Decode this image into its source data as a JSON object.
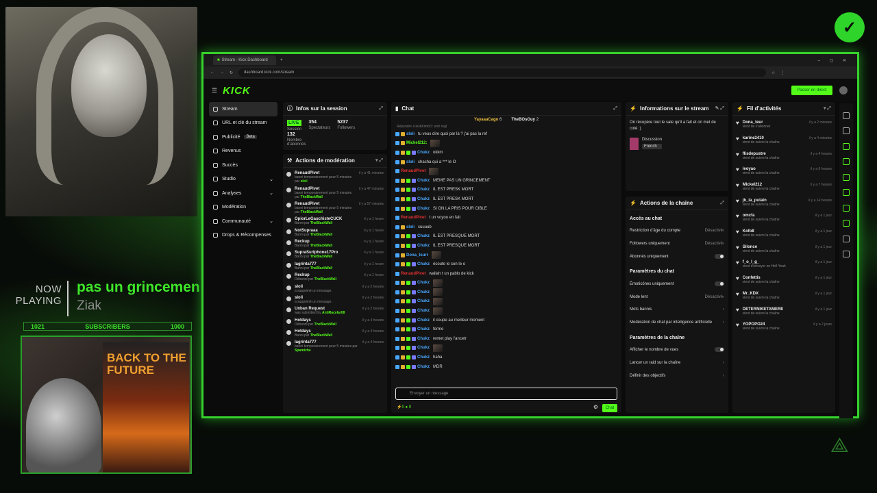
{
  "overlay": {
    "now_playing": "NOW PLAYING",
    "song": "pas un grincemen",
    "artist": "Ziak",
    "sub_left": "1021",
    "sub_label": "SUBSCRIBERS",
    "sub_right": "1000",
    "poster_text": "BACK TO THE FUTURE"
  },
  "browser": {
    "tab_title": "Stream - Kick Dashboard",
    "url": "dashboard.kick.com/stream"
  },
  "app": {
    "logo": "KICK",
    "go_live": "Passer en direct"
  },
  "sidebar": {
    "items": [
      {
        "label": "Stream"
      },
      {
        "label": "URL et clé du stream"
      },
      {
        "label": "Publicité",
        "badge": "Beta"
      },
      {
        "label": "Revenus"
      },
      {
        "label": "Succès"
      },
      {
        "label": "Studio"
      },
      {
        "label": "Analyses"
      },
      {
        "label": "Modération"
      },
      {
        "label": "Communauté"
      },
      {
        "label": "Drops & Récompenses"
      }
    ]
  },
  "session": {
    "title": "Infos sur la session",
    "live_badge": "LIVE",
    "stats": [
      {
        "value": "",
        "label": "Session"
      },
      {
        "value": "354",
        "label": "Spectateurs"
      },
      {
        "value": "5237",
        "label": "Followers"
      },
      {
        "value": "132",
        "label": "Nombre d'abonnés"
      }
    ]
  },
  "moderation": {
    "title": "Actions de modération",
    "rows": [
      {
        "name": "RenaudPivet",
        "pre": "banni temporairement pour 5 minutes par",
        "by": "sloli",
        "time": "il y a 41 minutes"
      },
      {
        "name": "RenaudPivet",
        "pre": "banni temporairement pour 5 minutes par",
        "by": "TheBlackWall",
        "time": "il y a 47 minutes"
      },
      {
        "name": "RenaudPivet",
        "pre": "banni temporairement pour 5 minutes par",
        "by": "TheBlackWall",
        "time": "il y a 57 minutes"
      },
      {
        "name": "OpiorLeGauchisteCUCK",
        "pre": "Banni par",
        "by": "TheBlackWall",
        "time": "il y a 1 heure"
      },
      {
        "name": "NotSupraaa",
        "pre": "Banni par",
        "by": "TheBlackWall",
        "time": "il y a 1 heure"
      },
      {
        "name": "Reckup",
        "pre": "Banni par",
        "by": "TheBlackWall",
        "time": "il y a 1 heure"
      },
      {
        "name": "SupraSurIphone17Pro",
        "pre": "Banni par",
        "by": "TheBlackWall",
        "time": "il y a 1 heure"
      },
      {
        "name": "lagrinta777",
        "pre": "Banni par",
        "by": "TheBlackWall",
        "time": "il y a 1 heure"
      },
      {
        "name": "Reckup",
        "pre": "Débanni par",
        "by": "TheBlackWall",
        "time": "il y a 1 heure"
      },
      {
        "name": "sloli",
        "pre": "a supprimé un message.",
        "by": "",
        "time": "il y a 2 heures"
      },
      {
        "name": "sloli",
        "pre": "a supprimé un message.",
        "by": "",
        "time": "il y a 2 heures"
      },
      {
        "name": "Unban Request",
        "pre": "was submitted by",
        "by": "AntiRacelar08",
        "time": "il y a 2 heures"
      },
      {
        "name": "Hotdays",
        "pre": "Débanni par",
        "by": "TheBlackWall",
        "time": "il y a 4 heures"
      },
      {
        "name": "Hotdays",
        "pre": "Banni par",
        "by": "TheBlackWall",
        "time": "il y a 4 heures"
      },
      {
        "name": "lagrinta777",
        "pre": "banni temporairement pour 5 minutes par",
        "by": "Spamiche",
        "time": "il y a 4 heures"
      }
    ]
  },
  "chat": {
    "title": "Chat",
    "pinned": [
      {
        "name": "YayaaaCago",
        "count": "6"
      },
      {
        "name": "TheBOsGuy",
        "count": "2"
      }
    ],
    "reply_note": "Répondre à leskKimbO: wsh regl",
    "rows": [
      {
        "user": "sloli",
        "color": "#4aa8ff",
        "text": "tu veux dire quoi par là ? j'ai pas la ref",
        "emote": false
      },
      {
        "user": "Mickel212:",
        "color": "#53fc18",
        "text": "",
        "emote": true
      },
      {
        "user": "Chukz",
        "color": "#4aa8ff",
        "text": "okkm",
        "emote": false
      },
      {
        "user": "sloli",
        "color": "#4aa8ff",
        "text": "chacha qui a *** le O",
        "emote": false
      },
      {
        "user": "RenaudPivet",
        "color": "#e03030",
        "text": "",
        "emote": true
      },
      {
        "user": "Chukz",
        "color": "#4aa8ff",
        "text": "MEME PAS UN GRINCEMENT",
        "emote": false
      },
      {
        "user": "Chukz",
        "color": "#4aa8ff",
        "text": "IL EST PRESK MORT",
        "emote": false
      },
      {
        "user": "Chukz",
        "color": "#4aa8ff",
        "text": "IL EST PRESK MORT",
        "emote": false
      },
      {
        "user": "Chukz",
        "color": "#4aa8ff",
        "text": "SI ON LA PRIS POUR CIBLE",
        "emote": false
      },
      {
        "user": "RenaudPivet",
        "color": "#e03030",
        "text": "t un voyou en fait",
        "emote": false
      },
      {
        "user": "sloli",
        "color": "#4aa8ff",
        "text": "suuuub",
        "emote": false
      },
      {
        "user": "Chukz",
        "color": "#4aa8ff",
        "text": "IL EST PRESQUE MORT",
        "emote": false
      },
      {
        "user": "Chukz",
        "color": "#4aa8ff",
        "text": "IL EST PRESQUE MORT",
        "emote": false
      },
      {
        "user": "Dona_teurr",
        "color": "#4aa8ff",
        "text": "",
        "emote": true
      },
      {
        "user": "Chukz",
        "color": "#4aa8ff",
        "text": "écoute le son le o",
        "emote": false
      },
      {
        "user": "RenaudPivet",
        "color": "#e03030",
        "text": "wallah t un pablo de kick",
        "emote": false
      },
      {
        "user": "Chukz",
        "color": "#4aa8ff",
        "text": "",
        "emote": true
      },
      {
        "user": "Chukz",
        "color": "#4aa8ff",
        "text": "",
        "emote": true
      },
      {
        "user": "Chukz",
        "color": "#4aa8ff",
        "text": "",
        "emote": true
      },
      {
        "user": "Chukz",
        "color": "#4aa8ff",
        "text": "",
        "emote": true
      },
      {
        "user": "Chukz",
        "color": "#4aa8ff",
        "text": "il coupe au meilleur moment",
        "emote": false
      },
      {
        "user": "Chukz",
        "color": "#4aa8ff",
        "text": "ferme",
        "emote": false
      },
      {
        "user": "Chukz",
        "color": "#4aa8ff",
        "text": "remet play l'ancetr",
        "emote": false
      },
      {
        "user": "Chukz",
        "color": "#4aa8ff",
        "text": "",
        "emote": true
      },
      {
        "user": "Chukz",
        "color": "#4aa8ff",
        "text": "haha",
        "emote": false
      },
      {
        "user": "Chukz",
        "color": "#4aa8ff",
        "text": "MDR",
        "emote": false
      }
    ],
    "input_placeholder": "Envoyer un message",
    "send": "Chat",
    "foot_left": "0",
    "foot_mid": "0"
  },
  "info": {
    "title": "Informations sur le stream",
    "description": "On récupère tout le sale qu'il a fait et on met de coté :)",
    "category": "Discussion",
    "language": "French"
  },
  "channel": {
    "title": "Actions de la chaîne",
    "sections": [
      {
        "title": "Accès au chat",
        "options": [
          {
            "label": "Restriction d'âge du compte",
            "value": "Désactivé"
          },
          {
            "label": "Followers uniquement",
            "value": "Désactivé"
          },
          {
            "label": "Abonnés uniquement",
            "value": "toggle"
          }
        ]
      },
      {
        "title": "Paramètres du chat",
        "options": [
          {
            "label": "Émoticônes uniquement",
            "value": "toggle"
          },
          {
            "label": "Mode lent",
            "value": "Désactivé"
          },
          {
            "label": "Mots bannis",
            "value": ""
          },
          {
            "label": "Modération de chat par intelligence artificielle",
            "value": ""
          }
        ]
      },
      {
        "title": "Paramètres de la chaîne",
        "options": [
          {
            "label": "Afficher le nombre de vues",
            "value": "toggle"
          },
          {
            "label": "Lancer un raid sur la chaîne",
            "value": ""
          },
          {
            "label": "Définir des objectifs",
            "value": ""
          }
        ]
      }
    ]
  },
  "feed": {
    "title": "Fil d'activités",
    "rows": [
      {
        "name": "Dona_teur",
        "sub": "vient de s'abonner",
        "time": "il y a 2 minutes"
      },
      {
        "name": "karine2410",
        "sub": "vient de suivre la chaîne",
        "time": "il y a 4 minutes"
      },
      {
        "name": "flisdepustre",
        "sub": "vient de suivre la chaîne",
        "time": "il y a 4 heures"
      },
      {
        "name": "leoyao",
        "sub": "vient de suivre la chaîne",
        "time": "il y a 6 heures"
      },
      {
        "name": "Mickel212",
        "sub": "vient de suivre la chaîne",
        "time": "il y a 7 heures"
      },
      {
        "name": "jb_la_putain",
        "sub": "vient de suivre la chaîne",
        "time": "il y a 14 heures"
      },
      {
        "name": "omcfa",
        "sub": "vient de suivre la chaîne",
        "time": "il y a 1 jour"
      },
      {
        "name": "Kofo8",
        "sub": "vient de suivre la chaîne",
        "time": "il y a 1 jour"
      },
      {
        "name": "Silonce",
        "sub": "vient de suivre la chaîne",
        "time": "il y a 1 jour"
      },
      {
        "name": "f_o_l_g_",
        "sub": "vient d'envoyer en Hell Yeah",
        "time": "il y a 1 jour"
      },
      {
        "name": "Confettis",
        "sub": "vient de suivre la chaîne",
        "time": "il y a 1 jour"
      },
      {
        "name": "Mr_KDX",
        "sub": "vient de suivre la chaîne",
        "time": "il y a 1 jour"
      },
      {
        "name": "DETERNIKETAMERE",
        "sub": "vient de suivre la chaîne",
        "time": "il y a 1 jour"
      },
      {
        "name": "YOPOPO24",
        "sub": "vient de suivre la chaîne",
        "time": "il y a 2 jours"
      }
    ]
  }
}
